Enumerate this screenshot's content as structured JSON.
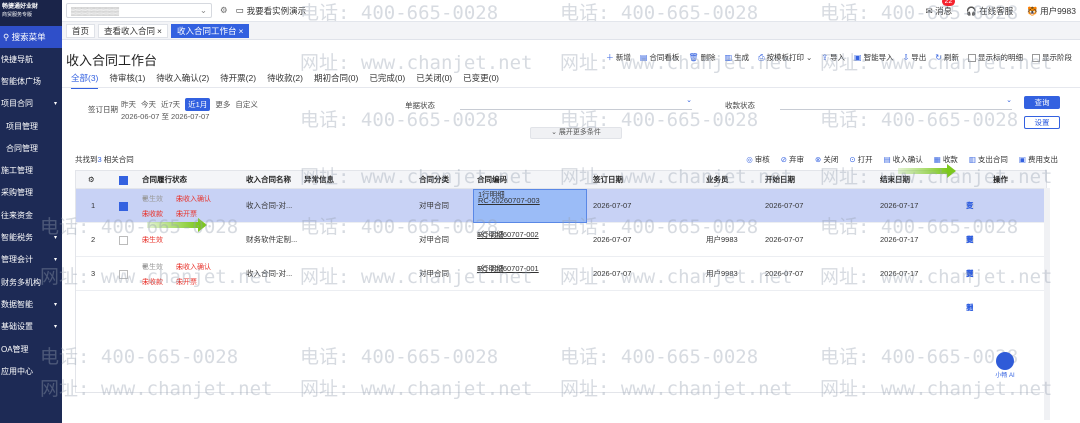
{
  "sidebar": {
    "logo_line1": "畅捷通好业财",
    "logo_line2": "商贸服务专版",
    "search": "搜索菜单",
    "items": [
      {
        "label": "快捷导航",
        "caret": false,
        "sub": false
      },
      {
        "label": "智能体广场",
        "caret": false,
        "sub": false
      },
      {
        "label": "项目合同",
        "caret": true,
        "sub": false
      },
      {
        "label": "项目管理",
        "caret": false,
        "sub": true
      },
      {
        "label": "合同管理",
        "caret": false,
        "sub": true
      },
      {
        "label": "施工管理",
        "caret": false,
        "sub": false
      },
      {
        "label": "采购管理",
        "caret": false,
        "sub": false
      },
      {
        "label": "往来资金",
        "caret": false,
        "sub": false
      },
      {
        "label": "智能税务",
        "caret": true,
        "sub": false
      },
      {
        "label": "管理会计",
        "caret": true,
        "sub": false
      },
      {
        "label": "财务多机构",
        "caret": false,
        "sub": false
      },
      {
        "label": "数据智能",
        "caret": true,
        "sub": false
      },
      {
        "label": "基础设置",
        "caret": true,
        "sub": false
      },
      {
        "label": "OA管理",
        "caret": false,
        "sub": false
      },
      {
        "label": "应用中心",
        "caret": false,
        "sub": false
      }
    ]
  },
  "topbar": {
    "demo": "我要看实例演示",
    "messages": "消息",
    "message_count": "22",
    "service": "在线客服",
    "user": "用户9983"
  },
  "page_tabs": [
    {
      "label": "首页",
      "active": false,
      "closable": false
    },
    {
      "label": "查看收入合同",
      "active": false,
      "closable": true
    },
    {
      "label": "收入合同工作台",
      "active": true,
      "closable": true
    }
  ],
  "title": "收入合同工作台",
  "toolbar": [
    "新增",
    "合同看板",
    "删除",
    "生成",
    "按模板打印",
    "导入",
    "智能导入",
    "导出",
    "刷新"
  ],
  "checks": [
    "显示标的明细",
    "显示阶段"
  ],
  "status_tabs": [
    "全部(3)",
    "待审核(1)",
    "待收入确认(2)",
    "待开票(2)",
    "待收款(2)",
    "期初合同(0)",
    "已完成(0)",
    "已关闭(0)",
    "已变更(0)"
  ],
  "filters": {
    "sign_date_label": "签订日期",
    "date_options": [
      "昨天",
      "今天",
      "近7天",
      "近1月",
      "更多",
      "自定义"
    ],
    "date_range": "2026-06-07 至 2026-07-07",
    "doc_status_label": "单据状态",
    "collect_status_label": "收款状态",
    "query": "查询",
    "settings": "设置",
    "expand": "展开更多条件"
  },
  "found": {
    "prefix": "共找到",
    "count": "3",
    "suffix": "相关合同"
  },
  "actions": [
    "审核",
    "弃审",
    "关闭",
    "打开",
    "收入确认",
    "收款",
    "支出合同",
    "费用支出"
  ],
  "columns": [
    "合同履行状态",
    "收入合同名称",
    "异常信息",
    "合同分类",
    "合同编码",
    "签订日期",
    "业务员",
    "开始日期",
    "结束日期",
    "操作"
  ],
  "rows": [
    {
      "no": "1",
      "checked": true,
      "status": [
        "已生效",
        "未收入确认",
        "未收款",
        "未开票"
      ],
      "name": "收入合同-对...",
      "category": "对甲合同",
      "code": "RC-20260707-003",
      "detail": "1行明细",
      "sign_date": "2026-07-07",
      "salesman": "",
      "start": "2026-07-07",
      "end": "2026-07-17"
    },
    {
      "no": "2",
      "checked": false,
      "status": [
        "未生效"
      ],
      "name": "财务软件定制...",
      "category": "对甲合同",
      "code": "RC-20260707-002",
      "detail": "1行明细",
      "sign_date": "2026-07-07",
      "salesman": "用户9983",
      "start": "2026-07-07",
      "end": "2026-07-17"
    },
    {
      "no": "3",
      "checked": false,
      "status": [
        "已生效",
        "未收入确认",
        "未收款",
        "未开票"
      ],
      "name": "收入合同-对...",
      "category": "对甲合同",
      "code": "RC-20260707-001",
      "detail": "1行明细",
      "sign_date": "2026-07-07",
      "salesman": "用户9983",
      "start": "2026-07-07",
      "end": "2026-07-17"
    }
  ],
  "ops": [
    "查看",
    "变更",
    "复制"
  ],
  "watermark": {
    "phone": "电话: 400-665-0028",
    "site": "网址: www.chanjet.net"
  },
  "bot_label": "小畅 AI",
  "accent": "#3361e0"
}
